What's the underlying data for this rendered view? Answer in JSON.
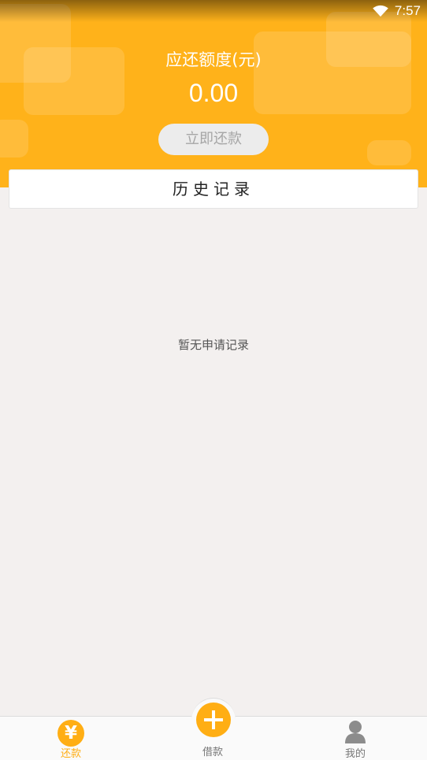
{
  "status_bar": {
    "time": "7:57",
    "wifi_icon": "wifi-icon"
  },
  "header": {
    "title": "应还额度(元)",
    "amount": "0.00",
    "repay_button": "立即还款",
    "accent_color": "#ffb21a"
  },
  "history": {
    "title": "历史记录"
  },
  "empty_state": {
    "message": "暂无申请记录"
  },
  "bottom_nav": {
    "items": [
      {
        "label": "还款",
        "icon": "yen-icon",
        "active": true
      },
      {
        "label": "借款",
        "icon": "plus-icon",
        "active": false
      },
      {
        "label": "我的",
        "icon": "user-icon",
        "active": false
      }
    ]
  }
}
